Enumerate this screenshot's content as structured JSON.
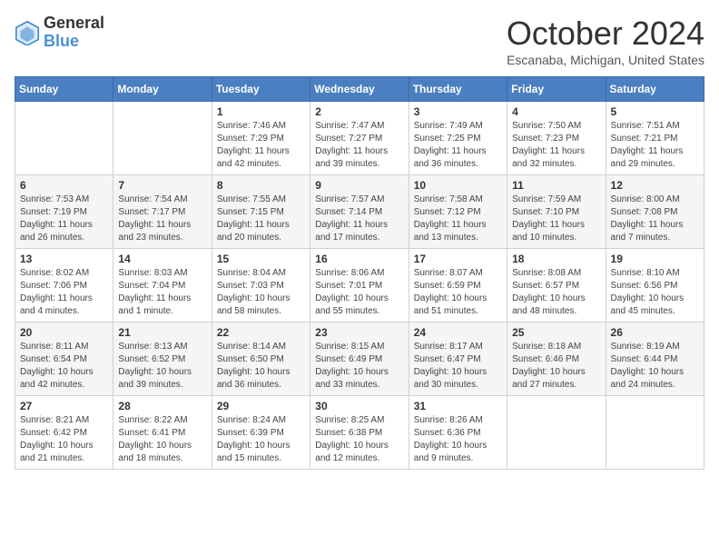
{
  "header": {
    "logo_general": "General",
    "logo_blue": "Blue",
    "title": "October 2024",
    "subtitle": "Escanaba, Michigan, United States"
  },
  "days_of_week": [
    "Sunday",
    "Monday",
    "Tuesday",
    "Wednesday",
    "Thursday",
    "Friday",
    "Saturday"
  ],
  "weeks": [
    [
      {
        "day": "",
        "sunrise": "",
        "sunset": "",
        "daylight": ""
      },
      {
        "day": "",
        "sunrise": "",
        "sunset": "",
        "daylight": ""
      },
      {
        "day": "1",
        "sunrise": "Sunrise: 7:46 AM",
        "sunset": "Sunset: 7:29 PM",
        "daylight": "Daylight: 11 hours and 42 minutes."
      },
      {
        "day": "2",
        "sunrise": "Sunrise: 7:47 AM",
        "sunset": "Sunset: 7:27 PM",
        "daylight": "Daylight: 11 hours and 39 minutes."
      },
      {
        "day": "3",
        "sunrise": "Sunrise: 7:49 AM",
        "sunset": "Sunset: 7:25 PM",
        "daylight": "Daylight: 11 hours and 36 minutes."
      },
      {
        "day": "4",
        "sunrise": "Sunrise: 7:50 AM",
        "sunset": "Sunset: 7:23 PM",
        "daylight": "Daylight: 11 hours and 32 minutes."
      },
      {
        "day": "5",
        "sunrise": "Sunrise: 7:51 AM",
        "sunset": "Sunset: 7:21 PM",
        "daylight": "Daylight: 11 hours and 29 minutes."
      }
    ],
    [
      {
        "day": "6",
        "sunrise": "Sunrise: 7:53 AM",
        "sunset": "Sunset: 7:19 PM",
        "daylight": "Daylight: 11 hours and 26 minutes."
      },
      {
        "day": "7",
        "sunrise": "Sunrise: 7:54 AM",
        "sunset": "Sunset: 7:17 PM",
        "daylight": "Daylight: 11 hours and 23 minutes."
      },
      {
        "day": "8",
        "sunrise": "Sunrise: 7:55 AM",
        "sunset": "Sunset: 7:15 PM",
        "daylight": "Daylight: 11 hours and 20 minutes."
      },
      {
        "day": "9",
        "sunrise": "Sunrise: 7:57 AM",
        "sunset": "Sunset: 7:14 PM",
        "daylight": "Daylight: 11 hours and 17 minutes."
      },
      {
        "day": "10",
        "sunrise": "Sunrise: 7:58 AM",
        "sunset": "Sunset: 7:12 PM",
        "daylight": "Daylight: 11 hours and 13 minutes."
      },
      {
        "day": "11",
        "sunrise": "Sunrise: 7:59 AM",
        "sunset": "Sunset: 7:10 PM",
        "daylight": "Daylight: 11 hours and 10 minutes."
      },
      {
        "day": "12",
        "sunrise": "Sunrise: 8:00 AM",
        "sunset": "Sunset: 7:08 PM",
        "daylight": "Daylight: 11 hours and 7 minutes."
      }
    ],
    [
      {
        "day": "13",
        "sunrise": "Sunrise: 8:02 AM",
        "sunset": "Sunset: 7:06 PM",
        "daylight": "Daylight: 11 hours and 4 minutes."
      },
      {
        "day": "14",
        "sunrise": "Sunrise: 8:03 AM",
        "sunset": "Sunset: 7:04 PM",
        "daylight": "Daylight: 11 hours and 1 minute."
      },
      {
        "day": "15",
        "sunrise": "Sunrise: 8:04 AM",
        "sunset": "Sunset: 7:03 PM",
        "daylight": "Daylight: 10 hours and 58 minutes."
      },
      {
        "day": "16",
        "sunrise": "Sunrise: 8:06 AM",
        "sunset": "Sunset: 7:01 PM",
        "daylight": "Daylight: 10 hours and 55 minutes."
      },
      {
        "day": "17",
        "sunrise": "Sunrise: 8:07 AM",
        "sunset": "Sunset: 6:59 PM",
        "daylight": "Daylight: 10 hours and 51 minutes."
      },
      {
        "day": "18",
        "sunrise": "Sunrise: 8:08 AM",
        "sunset": "Sunset: 6:57 PM",
        "daylight": "Daylight: 10 hours and 48 minutes."
      },
      {
        "day": "19",
        "sunrise": "Sunrise: 8:10 AM",
        "sunset": "Sunset: 6:56 PM",
        "daylight": "Daylight: 10 hours and 45 minutes."
      }
    ],
    [
      {
        "day": "20",
        "sunrise": "Sunrise: 8:11 AM",
        "sunset": "Sunset: 6:54 PM",
        "daylight": "Daylight: 10 hours and 42 minutes."
      },
      {
        "day": "21",
        "sunrise": "Sunrise: 8:13 AM",
        "sunset": "Sunset: 6:52 PM",
        "daylight": "Daylight: 10 hours and 39 minutes."
      },
      {
        "day": "22",
        "sunrise": "Sunrise: 8:14 AM",
        "sunset": "Sunset: 6:50 PM",
        "daylight": "Daylight: 10 hours and 36 minutes."
      },
      {
        "day": "23",
        "sunrise": "Sunrise: 8:15 AM",
        "sunset": "Sunset: 6:49 PM",
        "daylight": "Daylight: 10 hours and 33 minutes."
      },
      {
        "day": "24",
        "sunrise": "Sunrise: 8:17 AM",
        "sunset": "Sunset: 6:47 PM",
        "daylight": "Daylight: 10 hours and 30 minutes."
      },
      {
        "day": "25",
        "sunrise": "Sunrise: 8:18 AM",
        "sunset": "Sunset: 6:46 PM",
        "daylight": "Daylight: 10 hours and 27 minutes."
      },
      {
        "day": "26",
        "sunrise": "Sunrise: 8:19 AM",
        "sunset": "Sunset: 6:44 PM",
        "daylight": "Daylight: 10 hours and 24 minutes."
      }
    ],
    [
      {
        "day": "27",
        "sunrise": "Sunrise: 8:21 AM",
        "sunset": "Sunset: 6:42 PM",
        "daylight": "Daylight: 10 hours and 21 minutes."
      },
      {
        "day": "28",
        "sunrise": "Sunrise: 8:22 AM",
        "sunset": "Sunset: 6:41 PM",
        "daylight": "Daylight: 10 hours and 18 minutes."
      },
      {
        "day": "29",
        "sunrise": "Sunrise: 8:24 AM",
        "sunset": "Sunset: 6:39 PM",
        "daylight": "Daylight: 10 hours and 15 minutes."
      },
      {
        "day": "30",
        "sunrise": "Sunrise: 8:25 AM",
        "sunset": "Sunset: 6:38 PM",
        "daylight": "Daylight: 10 hours and 12 minutes."
      },
      {
        "day": "31",
        "sunrise": "Sunrise: 8:26 AM",
        "sunset": "Sunset: 6:36 PM",
        "daylight": "Daylight: 10 hours and 9 minutes."
      },
      {
        "day": "",
        "sunrise": "",
        "sunset": "",
        "daylight": ""
      },
      {
        "day": "",
        "sunrise": "",
        "sunset": "",
        "daylight": ""
      }
    ]
  ]
}
